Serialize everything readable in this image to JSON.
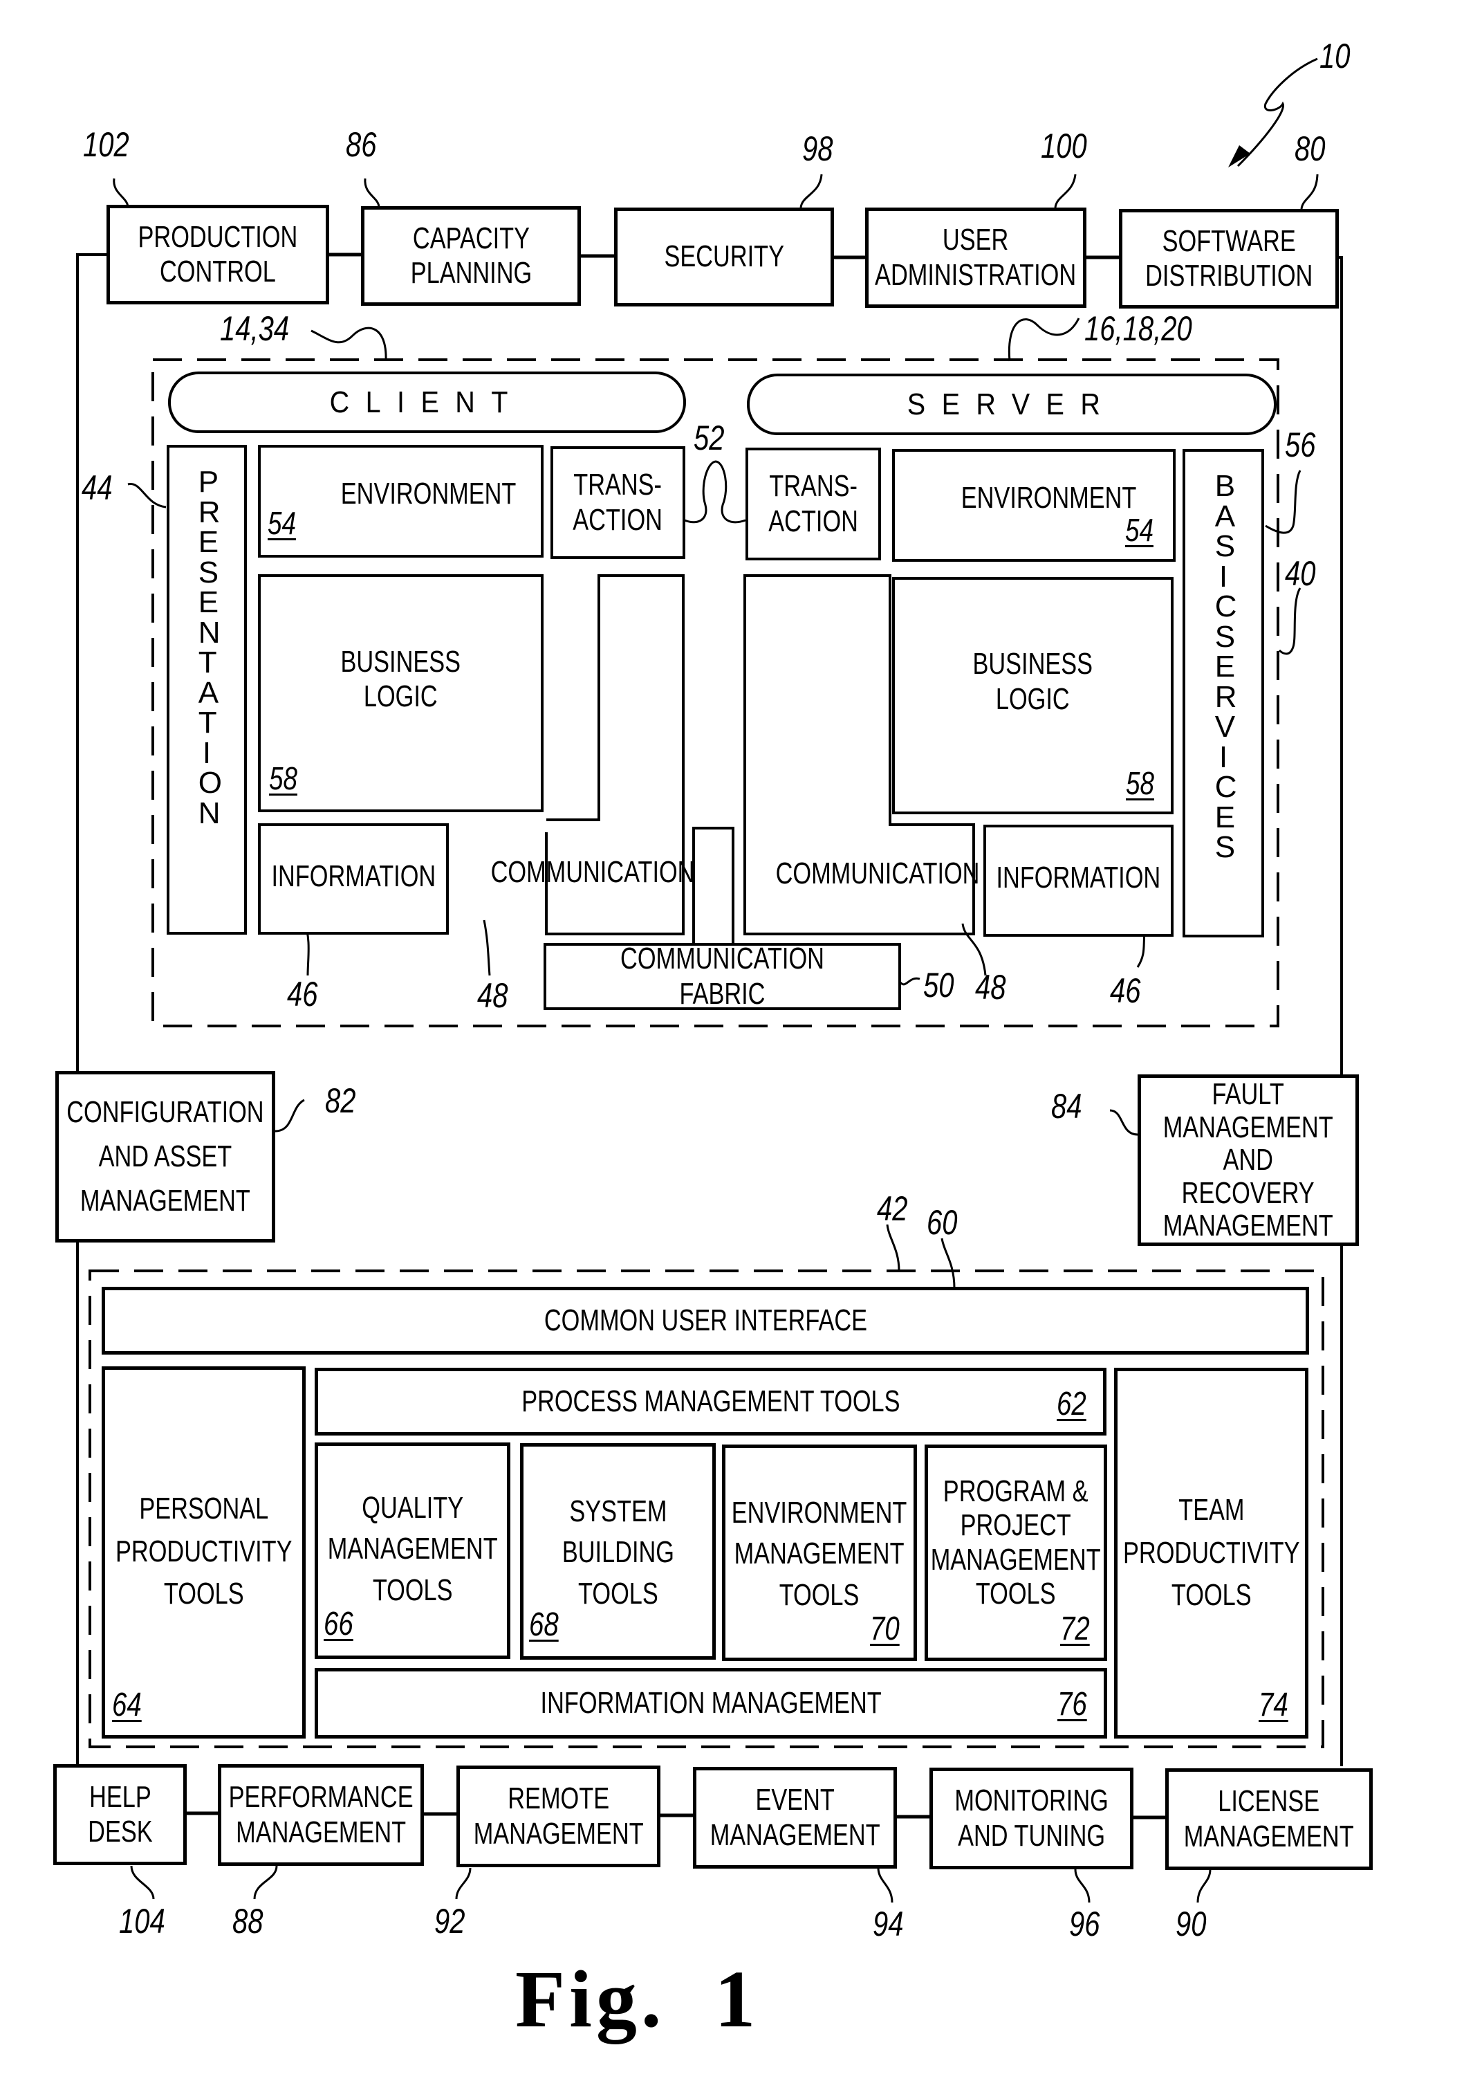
{
  "figure": {
    "caption": "Fig.  1",
    "system_ref": "10"
  },
  "top_row": [
    {
      "label": "PRODUCTION\nCONTROL",
      "ref": "102"
    },
    {
      "label": "CAPACITY\nPLANNING",
      "ref": "86"
    },
    {
      "label": "SECURITY",
      "ref": "98"
    },
    {
      "label": "USER\nADMINISTRATION",
      "ref": "100"
    },
    {
      "label": "SOFTWARE\nDISTRIBUTION",
      "ref": "80"
    }
  ],
  "architecture": {
    "ref": "40",
    "client": {
      "label": "CLIENT",
      "ref": "14,34"
    },
    "server": {
      "label": "SERVER",
      "ref": "16,18,20"
    },
    "presentation": {
      "label": "PRESENTATION",
      "ref": "44"
    },
    "basic_services": {
      "label": "BASICSERVICES",
      "ref": "56"
    },
    "transaction_link_ref": "52",
    "client_side": {
      "environment": {
        "label": "ENVIRONMENT",
        "ref": "54"
      },
      "transaction": {
        "label": "TRANS-\nACTION"
      },
      "business_logic": {
        "label": "BUSINESS\nLOGIC",
        "ref": "58"
      },
      "information": {
        "label": "INFORMATION",
        "ref": "46"
      },
      "communication": {
        "label": "COMMUNICATION",
        "ref": "48"
      }
    },
    "server_side": {
      "transaction": {
        "label": "TRANS-\nACTION"
      },
      "environment": {
        "label": "ENVIRONMENT",
        "ref": "54"
      },
      "business_logic": {
        "label": "BUSINESS\nLOGIC",
        "ref": "58"
      },
      "communication": {
        "label": "COMMUNICATION",
        "ref": "48"
      },
      "information": {
        "label": "INFORMATION",
        "ref": "46"
      }
    },
    "communication_fabric": {
      "label": "COMMUNICATION  FABRIC",
      "ref": "50"
    }
  },
  "side_boxes": {
    "configuration": {
      "label": "CONFIGURATION\nAND  ASSET\nMANAGEMENT",
      "ref": "82"
    },
    "fault": {
      "label": "FAULT\nMANAGEMENT\nAND  RECOVERY\nMANAGEMENT",
      "ref": "84"
    }
  },
  "development": {
    "ref": "42",
    "group_ref": "60",
    "common_ui": {
      "label": "COMMON  USER  INTERFACE"
    },
    "personal": {
      "label": "PERSONAL\nPRODUCTIVITY\nTOOLS",
      "ref": "64"
    },
    "process": {
      "label": "PROCESS  MANAGEMENT  TOOLS",
      "ref": "62"
    },
    "team": {
      "label": "TEAM\nPRODUCTIVITY\nTOOLS",
      "ref": "74"
    },
    "tools": [
      {
        "label": "QUALITY\nMANAGEMENT\nTOOLS",
        "ref": "66"
      },
      {
        "label": "SYSTEM\nBUILDING\nTOOLS",
        "ref": "68"
      },
      {
        "label": "ENVIRONMENT\nMANAGEMENT\nTOOLS",
        "ref": "70"
      },
      {
        "label": "PROGRAM  &\nPROJECT\nMANAGEMENT\nTOOLS",
        "ref": "72"
      }
    ],
    "information_management": {
      "label": "INFORMATION  MANAGEMENT",
      "ref": "76"
    }
  },
  "bottom_row": [
    {
      "label": "HELP\nDESK",
      "ref": "104"
    },
    {
      "label": "PERFORMANCE\nMANAGEMENT",
      "ref": "88"
    },
    {
      "label": "REMOTE\nMANAGEMENT",
      "ref": "92"
    },
    {
      "label": "EVENT\nMANAGEMENT",
      "ref": "94"
    },
    {
      "label": "MONITORING\nAND  TUNING",
      "ref": "96"
    },
    {
      "label": "LICENSE\nMANAGEMENT",
      "ref": "90"
    }
  ]
}
